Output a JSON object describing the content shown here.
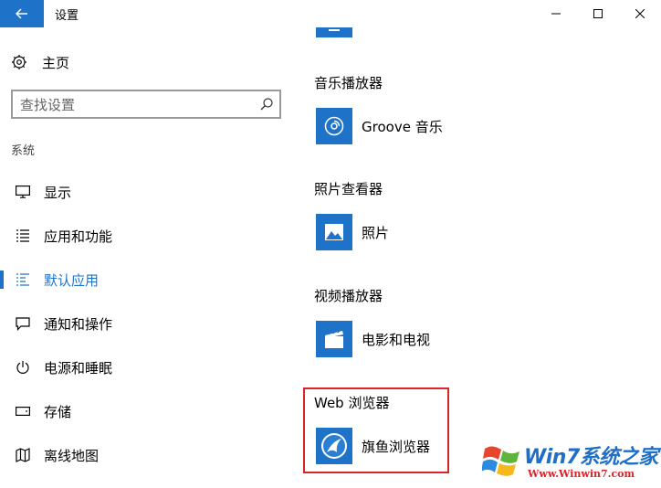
{
  "window": {
    "title": "设置",
    "controls": {
      "minimize_icon": "minimize-icon",
      "maximize_icon": "maximize-icon",
      "close_icon": "close-icon"
    }
  },
  "sidebar": {
    "home_label": "主页",
    "search": {
      "placeholder": "查找设置",
      "value": ""
    },
    "section_label": "系统",
    "items": [
      {
        "label": "显示",
        "icon": "monitor-icon",
        "active": false
      },
      {
        "label": "应用和功能",
        "icon": "apps-list-icon",
        "active": false
      },
      {
        "label": "默认应用",
        "icon": "default-apps-icon",
        "active": true
      },
      {
        "label": "通知和操作",
        "icon": "notification-icon",
        "active": false
      },
      {
        "label": "电源和睡眠",
        "icon": "power-icon",
        "active": false
      },
      {
        "label": "存储",
        "icon": "storage-icon",
        "active": false
      },
      {
        "label": "离线地图",
        "icon": "map-icon",
        "active": false
      }
    ]
  },
  "main": {
    "categories": [
      {
        "label": "音乐播放器",
        "app": "Groove 音乐",
        "icon": "groove-music-icon"
      },
      {
        "label": "照片查看器",
        "app": "照片",
        "icon": "photos-icon"
      },
      {
        "label": "视频播放器",
        "app": "电影和电视",
        "icon": "movies-tv-icon"
      },
      {
        "label": "Web 浏览器",
        "app": "旗鱼浏览器",
        "icon": "qiyu-browser-icon"
      }
    ]
  },
  "watermark": {
    "brand": "Win7系统之家",
    "url": "Www.Winwin7.com"
  },
  "colors": {
    "accent": "#1e73c8",
    "highlight": "#d9252a"
  }
}
